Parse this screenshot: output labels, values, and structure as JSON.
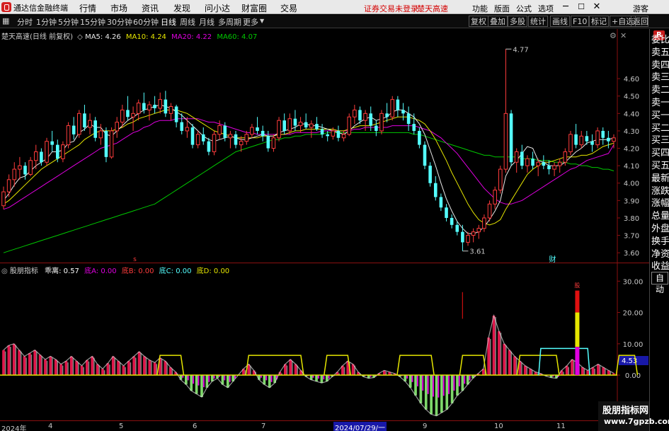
{
  "app": {
    "title": "通达信金融终端"
  },
  "menu": [
    "行情",
    "市场",
    "资讯",
    "发现",
    "问小达",
    "财富圈",
    "交易"
  ],
  "status_links": {
    "login": "证券交易未登录",
    "stock": "楚天高速"
  },
  "right_menu": [
    "功能",
    "版面",
    "公式",
    "选项"
  ],
  "guest": "游客",
  "periods": [
    "分时",
    "1分钟",
    "5分钟",
    "15分钟",
    "30分钟",
    "60分钟",
    "日线",
    "周线",
    "月线",
    "多周期",
    "更多"
  ],
  "active_period": "日线",
  "tools": [
    "复权",
    "叠加",
    "多股",
    "统计",
    "画线",
    "F10",
    "标记",
    "+自选",
    "返回"
  ],
  "side_tabs": [
    "委比",
    "卖五",
    "卖四",
    "卖三",
    "卖二",
    "卖一",
    "买一",
    "买二",
    "买三",
    "买四",
    "买五",
    "最新",
    "涨跌",
    "涨幅",
    "总量",
    "外盘",
    "换手",
    "净资",
    "收益"
  ],
  "side_r": "R",
  "auto_label": "自动",
  "price_chart": {
    "stock_label": "楚天高速(日线 前复权)",
    "ma": [
      {
        "label": "MA5: 4.26",
        "color": "#e8e8e8"
      },
      {
        "label": "MA10: 4.24",
        "color": "#e6e600"
      },
      {
        "label": "MA20: 4.22",
        "color": "#e000e0"
      },
      {
        "label": "MA60: 4.07",
        "color": "#00c800"
      }
    ],
    "y_ticks": [
      "4.60",
      "4.50",
      "4.40",
      "4.30",
      "4.20",
      "4.10",
      "4.00",
      "3.90",
      "3.80",
      "3.70",
      "3.60"
    ],
    "high_label": "4.77",
    "low_label": "3.61",
    "marker_s": "s",
    "marker_cai": "财",
    "colors": {
      "up": "#ff3c3c",
      "down": "#54ffff",
      "ma5": "#e8e8e8",
      "ma10": "#e6e600",
      "ma20": "#e000e0",
      "ma60": "#00c800"
    }
  },
  "chart_data": {
    "type": "candlestick",
    "ylim": [
      3.56,
      4.82
    ],
    "ohlc": [
      [
        3.87,
        3.98,
        3.85,
        3.95
      ],
      [
        3.95,
        4.05,
        3.92,
        4.02
      ],
      [
        4.02,
        4.12,
        3.98,
        4.08
      ],
      [
        4.08,
        4.15,
        4.02,
        4.1
      ],
      [
        4.1,
        4.12,
        4.02,
        4.05
      ],
      [
        4.05,
        4.15,
        4.04,
        4.13
      ],
      [
        4.13,
        4.22,
        4.08,
        4.18
      ],
      [
        4.18,
        4.2,
        4.1,
        4.12
      ],
      [
        4.12,
        4.26,
        4.1,
        4.24
      ],
      [
        4.24,
        4.3,
        4.18,
        4.22
      ],
      [
        4.22,
        4.25,
        4.12,
        4.14
      ],
      [
        4.14,
        4.24,
        4.12,
        4.22
      ],
      [
        4.22,
        4.35,
        4.2,
        4.33
      ],
      [
        4.33,
        4.38,
        4.25,
        4.28
      ],
      [
        4.28,
        4.42,
        4.26,
        4.4
      ],
      [
        4.4,
        4.45,
        4.3,
        4.32
      ],
      [
        4.32,
        4.4,
        4.28,
        4.36
      ],
      [
        4.36,
        4.38,
        4.24,
        4.26
      ],
      [
        4.26,
        4.34,
        4.22,
        4.3
      ],
      [
        4.3,
        4.32,
        4.12,
        4.15
      ],
      [
        4.15,
        4.32,
        4.14,
        4.3
      ],
      [
        4.3,
        4.38,
        4.26,
        4.35
      ],
      [
        4.35,
        4.45,
        4.32,
        4.42
      ],
      [
        4.42,
        4.5,
        4.36,
        4.38
      ],
      [
        4.38,
        4.44,
        4.3,
        4.4
      ],
      [
        4.4,
        4.48,
        4.36,
        4.46
      ],
      [
        4.46,
        4.52,
        4.4,
        4.42
      ],
      [
        4.42,
        4.47,
        4.36,
        4.45
      ],
      [
        4.45,
        4.5,
        4.4,
        4.43
      ],
      [
        4.43,
        4.52,
        4.4,
        4.48
      ],
      [
        4.48,
        4.53,
        4.38,
        4.4
      ],
      [
        4.4,
        4.46,
        4.36,
        4.44
      ],
      [
        4.44,
        4.45,
        4.32,
        4.35
      ],
      [
        4.35,
        4.4,
        4.28,
        4.3
      ],
      [
        4.3,
        4.38,
        4.26,
        4.32
      ],
      [
        4.32,
        4.34,
        4.2,
        4.22
      ],
      [
        4.22,
        4.3,
        4.2,
        4.28
      ],
      [
        4.28,
        4.32,
        4.22,
        4.24
      ],
      [
        4.24,
        4.26,
        4.16,
        4.18
      ],
      [
        4.18,
        4.3,
        4.16,
        4.28
      ],
      [
        4.28,
        4.36,
        4.25,
        4.33
      ],
      [
        4.33,
        4.35,
        4.24,
        4.26
      ],
      [
        4.26,
        4.3,
        4.2,
        4.28
      ],
      [
        4.28,
        4.3,
        4.2,
        4.22
      ],
      [
        4.22,
        4.27,
        4.18,
        4.24
      ],
      [
        4.24,
        4.3,
        4.22,
        4.28
      ],
      [
        4.28,
        4.34,
        4.26,
        4.32
      ],
      [
        4.32,
        4.38,
        4.28,
        4.3
      ],
      [
        4.3,
        4.33,
        4.24,
        4.27
      ],
      [
        4.27,
        4.3,
        4.18,
        4.2
      ],
      [
        4.2,
        4.28,
        4.18,
        4.26
      ],
      [
        4.26,
        4.38,
        4.24,
        4.36
      ],
      [
        4.36,
        4.4,
        4.28,
        4.3
      ],
      [
        4.3,
        4.4,
        4.28,
        4.37
      ],
      [
        4.37,
        4.42,
        4.3,
        4.33
      ],
      [
        4.33,
        4.38,
        4.29,
        4.35
      ],
      [
        4.35,
        4.4,
        4.31,
        4.32
      ],
      [
        4.32,
        4.36,
        4.26,
        4.34
      ],
      [
        4.34,
        4.38,
        4.3,
        4.31
      ],
      [
        4.31,
        4.34,
        4.26,
        4.28
      ],
      [
        4.28,
        4.3,
        4.24,
        4.27
      ],
      [
        4.27,
        4.32,
        4.25,
        4.3
      ],
      [
        4.3,
        4.33,
        4.24,
        4.26
      ],
      [
        4.26,
        4.3,
        4.24,
        4.28
      ],
      [
        4.28,
        4.4,
        4.27,
        4.38
      ],
      [
        4.38,
        4.45,
        4.34,
        4.42
      ],
      [
        4.42,
        4.44,
        4.34,
        4.36
      ],
      [
        4.36,
        4.42,
        4.3,
        4.4
      ],
      [
        4.4,
        4.44,
        4.3,
        4.33
      ],
      [
        4.33,
        4.36,
        4.27,
        4.3
      ],
      [
        4.3,
        4.42,
        4.28,
        4.4
      ],
      [
        4.4,
        4.46,
        4.35,
        4.38
      ],
      [
        4.38,
        4.5,
        4.36,
        4.48
      ],
      [
        4.48,
        4.5,
        4.38,
        4.42
      ],
      [
        4.42,
        4.46,
        4.36,
        4.4
      ],
      [
        4.4,
        4.44,
        4.3,
        4.34
      ],
      [
        4.34,
        4.4,
        4.28,
        4.3
      ],
      [
        4.3,
        4.32,
        4.2,
        4.22
      ],
      [
        4.22,
        4.24,
        4.08,
        4.1
      ],
      [
        4.1,
        4.12,
        3.98,
        4.0
      ],
      [
        4.0,
        4.04,
        3.9,
        3.92
      ],
      [
        3.92,
        3.94,
        3.84,
        3.86
      ],
      [
        3.86,
        3.88,
        3.78,
        3.8
      ],
      [
        3.8,
        3.82,
        3.74,
        3.76
      ],
      [
        3.76,
        3.78,
        3.7,
        3.72
      ],
      [
        3.72,
        3.76,
        3.61,
        3.66
      ],
      [
        3.66,
        3.72,
        3.64,
        3.7
      ],
      [
        3.7,
        3.74,
        3.66,
        3.72
      ],
      [
        3.72,
        3.76,
        3.68,
        3.74
      ],
      [
        3.74,
        3.82,
        3.72,
        3.8
      ],
      [
        3.8,
        3.9,
        3.78,
        3.88
      ],
      [
        3.88,
        3.98,
        3.85,
        3.96
      ],
      [
        3.96,
        4.1,
        3.94,
        4.08
      ],
      [
        4.08,
        4.77,
        4.06,
        4.4
      ],
      [
        4.4,
        4.42,
        4.1,
        4.12
      ],
      [
        4.12,
        4.2,
        4.06,
        4.18
      ],
      [
        4.18,
        4.22,
        4.08,
        4.1
      ],
      [
        4.1,
        4.16,
        4.06,
        4.14
      ],
      [
        4.14,
        4.18,
        4.08,
        4.1
      ],
      [
        4.1,
        4.14,
        4.04,
        4.12
      ],
      [
        4.12,
        4.16,
        4.08,
        4.1
      ],
      [
        4.1,
        4.13,
        4.05,
        4.08
      ],
      [
        4.08,
        4.12,
        4.04,
        4.1
      ],
      [
        4.1,
        4.14,
        4.06,
        4.12
      ],
      [
        4.12,
        4.2,
        4.1,
        4.18
      ],
      [
        4.18,
        4.3,
        4.16,
        4.28
      ],
      [
        4.28,
        4.34,
        4.2,
        4.22
      ],
      [
        4.22,
        4.3,
        4.2,
        4.27
      ],
      [
        4.27,
        4.3,
        4.22,
        4.24
      ],
      [
        4.24,
        4.28,
        4.18,
        4.22
      ],
      [
        4.22,
        4.32,
        4.2,
        4.3
      ],
      [
        4.3,
        4.32,
        4.22,
        4.26
      ],
      [
        4.26,
        4.3,
        4.2,
        4.24
      ],
      [
        4.24,
        4.28,
        4.2,
        4.26
      ]
    ],
    "ma5": [
      3.9,
      3.94,
      3.99,
      4.03,
      4.04,
      4.07,
      4.1,
      4.12,
      4.14,
      4.18,
      4.18,
      4.19,
      4.23,
      4.24,
      4.29,
      4.31,
      4.34,
      4.32,
      4.32,
      4.28,
      4.27,
      4.3,
      4.33,
      4.36,
      4.38,
      4.4,
      4.42,
      4.43,
      4.44,
      4.45,
      4.44,
      4.43,
      4.41,
      4.39,
      4.36,
      4.33,
      4.3,
      4.27,
      4.25,
      4.24,
      4.25,
      4.26,
      4.27,
      4.26,
      4.25,
      4.25,
      4.26,
      4.27,
      4.28,
      4.27,
      4.27,
      4.29,
      4.3,
      4.31,
      4.32,
      4.34,
      4.34,
      4.33,
      4.33,
      4.32,
      4.31,
      4.3,
      4.29,
      4.28,
      4.3,
      4.33,
      4.35,
      4.37,
      4.38,
      4.36,
      4.37,
      4.38,
      4.41,
      4.42,
      4.42,
      4.4,
      4.38,
      4.34,
      4.28,
      4.19,
      4.1,
      4.0,
      3.91,
      3.84,
      3.78,
      3.74,
      3.71,
      3.71,
      3.72,
      3.75,
      3.79,
      3.84,
      3.9,
      4.04,
      4.1,
      4.13,
      4.17,
      4.21,
      4.2,
      4.13,
      4.12,
      4.1,
      4.1,
      4.1,
      4.12,
      4.15,
      4.18,
      4.2,
      4.23,
      4.24,
      4.25,
      4.25,
      4.25,
      4.26
    ],
    "ma10": [
      3.88,
      3.9,
      3.93,
      3.96,
      3.99,
      4.02,
      4.05,
      4.08,
      4.1,
      4.12,
      4.14,
      4.16,
      4.18,
      4.2,
      4.22,
      4.25,
      4.27,
      4.29,
      4.3,
      4.3,
      4.3,
      4.31,
      4.32,
      4.34,
      4.35,
      4.37,
      4.38,
      4.39,
      4.4,
      4.41,
      4.42,
      4.42,
      4.42,
      4.41,
      4.4,
      4.38,
      4.36,
      4.34,
      4.32,
      4.3,
      4.29,
      4.28,
      4.27,
      4.26,
      4.26,
      4.26,
      4.26,
      4.26,
      4.27,
      4.27,
      4.27,
      4.28,
      4.28,
      4.29,
      4.3,
      4.3,
      4.31,
      4.31,
      4.31,
      4.31,
      4.31,
      4.31,
      4.3,
      4.3,
      4.31,
      4.32,
      4.33,
      4.33,
      4.33,
      4.34,
      4.35,
      4.36,
      4.37,
      4.38,
      4.38,
      4.38,
      4.37,
      4.36,
      4.34,
      4.3,
      4.25,
      4.19,
      4.13,
      4.06,
      4.0,
      3.94,
      3.88,
      3.83,
      3.79,
      3.77,
      3.76,
      3.77,
      3.79,
      3.85,
      3.9,
      3.95,
      4.0,
      4.05,
      4.08,
      4.1,
      4.12,
      4.12,
      4.13,
      4.14,
      4.15,
      4.15,
      4.15,
      4.16,
      4.16,
      4.17,
      4.19,
      4.21,
      4.22,
      4.23
    ],
    "ma20": [
      3.85,
      3.86,
      3.88,
      3.9,
      3.92,
      3.94,
      3.96,
      3.98,
      4.0,
      4.02,
      4.04,
      4.06,
      4.08,
      4.1,
      4.12,
      4.14,
      4.16,
      4.18,
      4.2,
      4.21,
      4.22,
      4.23,
      4.25,
      4.27,
      4.29,
      4.3,
      4.32,
      4.33,
      4.35,
      4.36,
      4.36,
      4.36,
      4.37,
      4.37,
      4.37,
      4.37,
      4.37,
      4.36,
      4.35,
      4.35,
      4.34,
      4.33,
      4.32,
      4.31,
      4.3,
      4.29,
      4.29,
      4.28,
      4.28,
      4.28,
      4.28,
      4.28,
      4.28,
      4.28,
      4.29,
      4.29,
      4.29,
      4.29,
      4.29,
      4.3,
      4.3,
      4.3,
      4.3,
      4.3,
      4.3,
      4.31,
      4.31,
      4.32,
      4.32,
      4.32,
      4.32,
      4.32,
      4.33,
      4.33,
      4.33,
      4.33,
      4.33,
      4.32,
      4.31,
      4.3,
      4.28,
      4.26,
      4.23,
      4.2,
      4.17,
      4.13,
      4.09,
      4.05,
      4.01,
      3.97,
      3.94,
      3.91,
      3.89,
      3.88,
      3.88,
      3.89,
      3.9,
      3.92,
      3.94,
      3.96,
      3.98,
      4.0,
      4.02,
      4.04,
      4.06,
      4.08,
      4.09,
      4.11,
      4.13,
      4.14,
      4.15,
      4.16,
      4.17,
      4.22
    ],
    "ma60": [
      3.6,
      3.61,
      3.62,
      3.63,
      3.64,
      3.65,
      3.66,
      3.67,
      3.68,
      3.69,
      3.7,
      3.71,
      3.72,
      3.73,
      3.74,
      3.75,
      3.76,
      3.77,
      3.78,
      3.79,
      3.8,
      3.81,
      3.82,
      3.83,
      3.84,
      3.85,
      3.86,
      3.87,
      3.88,
      3.9,
      3.92,
      3.94,
      3.96,
      3.98,
      4.0,
      4.02,
      4.04,
      4.06,
      4.08,
      4.1,
      4.12,
      4.14,
      4.16,
      4.18,
      4.19,
      4.2,
      4.21,
      4.22,
      4.23,
      4.24,
      4.25,
      4.25,
      4.26,
      4.26,
      4.27,
      4.27,
      4.28,
      4.28,
      4.28,
      4.28,
      4.29,
      4.29,
      4.29,
      4.29,
      4.29,
      4.29,
      4.29,
      4.29,
      4.29,
      4.29,
      4.29,
      4.29,
      4.29,
      4.29,
      4.29,
      4.29,
      4.28,
      4.28,
      4.27,
      4.26,
      4.25,
      4.24,
      4.23,
      4.22,
      4.21,
      4.2,
      4.19,
      4.18,
      4.17,
      4.16,
      4.16,
      4.15,
      4.15,
      4.15,
      4.15,
      4.15,
      4.14,
      4.14,
      4.14,
      4.13,
      4.13,
      4.13,
      4.12,
      4.12,
      4.12,
      4.11,
      4.11,
      4.1,
      4.1,
      4.09,
      4.09,
      4.08,
      4.08,
      4.07
    ]
  },
  "indicator": {
    "name": "股朋指标",
    "values": [
      {
        "key": "乖离: 0.57",
        "color": "#ffffff"
      },
      {
        "key": "底A: 0.00",
        "color": "#e000e0"
      },
      {
        "key": "底B: 0.00",
        "color": "#ff3c3c"
      },
      {
        "key": "底C: 0.00",
        "color": "#54ffff"
      },
      {
        "key": "底D: 0.00",
        "color": "#e6e600"
      }
    ],
    "y_ticks": [
      "30.00",
      "20.00",
      "10.00",
      "0.00"
    ],
    "current_value": "4.53",
    "ylim": [
      -14,
      33
    ],
    "bias": [
      8,
      9.5,
      10,
      8,
      6,
      7,
      8,
      6.5,
      5,
      6,
      5,
      3.5,
      4.5,
      6,
      4.5,
      3,
      4.8,
      6,
      3.5,
      2,
      3.8,
      6,
      4.5,
      3,
      4.5,
      6,
      7.5,
      6,
      4.8,
      4,
      5.5,
      4.5,
      2.5,
      1,
      -1.5,
      -3,
      -5,
      -6,
      -7,
      -4,
      -2,
      -1,
      -3,
      -4,
      -2,
      0,
      2,
      3.5,
      1.5,
      -1.5,
      -3,
      -4,
      -2.5,
      1,
      3.5,
      5,
      3.5,
      1.5,
      -0.5,
      -1.5,
      -2,
      -2.5,
      -2,
      -0.5,
      1,
      3,
      4.5,
      3.5,
      1,
      -0.5,
      -1,
      -0.8,
      0.6,
      1.5,
      1,
      0.5,
      -0.5,
      -2,
      -4,
      -6.5,
      -9,
      -11,
      -12.5,
      -13,
      -12,
      -11,
      -9,
      -6.5,
      -5,
      -3,
      -1,
      0.5,
      2,
      12,
      19,
      14,
      10,
      8,
      6,
      4.5,
      3,
      2,
      1,
      0.5,
      -0.3,
      -0.8,
      -1,
      1.5,
      3,
      5,
      4,
      2.5,
      1.5,
      2.5,
      3.5,
      2.5,
      1.5,
      0.6
    ],
    "yellow_steps": [
      [
        30,
        34
      ],
      [
        47,
        57
      ],
      [
        62,
        66
      ],
      [
        76,
        82
      ],
      [
        88,
        92
      ],
      [
        99,
        106
      ],
      [
        118,
        121
      ]
    ],
    "cyan_step": [
      103,
      112
    ],
    "red_spike_x": 88,
    "signal_x": 110,
    "signal_label": "股"
  },
  "dates": [
    "2024年",
    "4",
    "5",
    "6",
    "7",
    "9",
    "10",
    "11"
  ],
  "date_cursor": "2024/07/29/一",
  "watermark": {
    "line1": "股朋指标网",
    "line2": "www.7gpzb.com"
  }
}
